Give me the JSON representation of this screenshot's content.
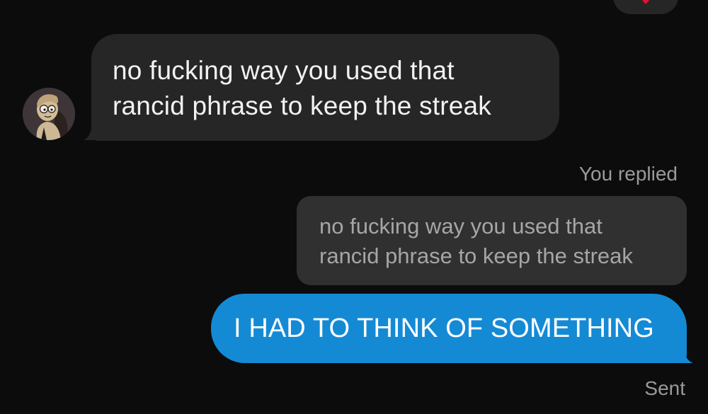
{
  "conversation": {
    "incoming_message": {
      "lines": [
        "no fucking way you used that",
        "rancid phrase to keep the streak"
      ]
    },
    "reply_indicator": "You replied",
    "quoted_message": {
      "lines": [
        "no fucking way you used that",
        "rancid phrase to keep the streak"
      ]
    },
    "outgoing_message": "I HAD TO THINK OF SOMETHING",
    "status": "Sent"
  },
  "icons": {
    "avatar": "contact-avatar",
    "reaction": "heart-icon"
  },
  "colors": {
    "background": "#0c0c0c",
    "incoming_bubble": "#262626",
    "quoted_bubble": "#303030",
    "outgoing_bubble": "#148ad5",
    "reaction_heart": "#e0142e"
  }
}
